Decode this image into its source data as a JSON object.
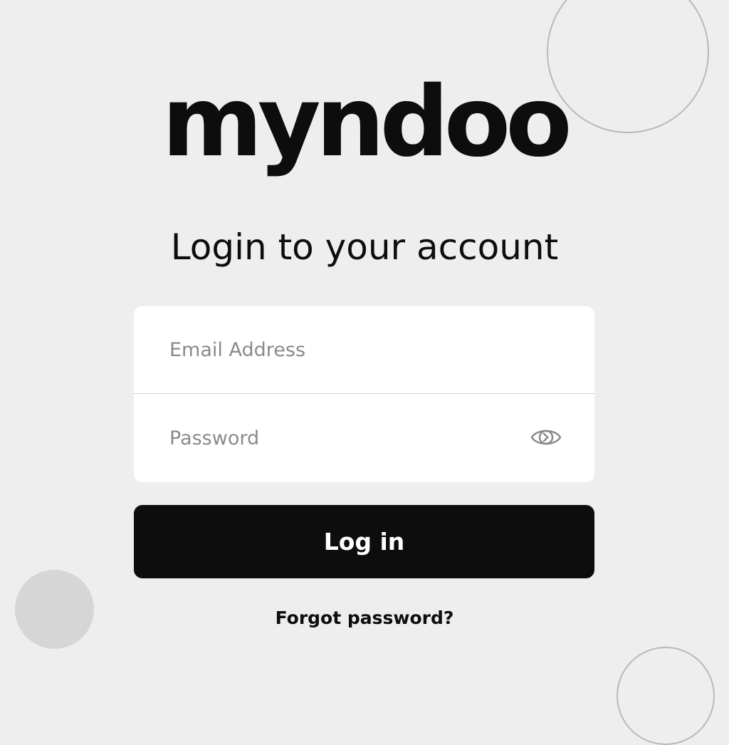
{
  "brand": {
    "logo_text": "myndoo"
  },
  "login": {
    "heading": "Login to your account",
    "email_placeholder": "Email Address",
    "password_placeholder": "Password",
    "submit_label": "Log in",
    "forgot_password_label": "Forgot password?"
  },
  "icons": {
    "password_toggle": "eye-icon"
  },
  "colors": {
    "background": "#eeeeee",
    "primary": "#0d0d0d",
    "card": "#ffffff",
    "placeholder": "#8a8a8a",
    "decoration_outline": "#b9b9b9",
    "decoration_fill": "#d6d6d6"
  }
}
